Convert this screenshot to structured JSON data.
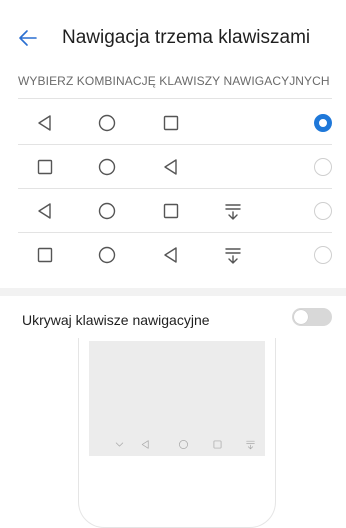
{
  "header": {
    "back_icon": "arrow-left-icon",
    "title": "Nawigacja trzema klawiszami"
  },
  "section": {
    "label": "WYBIERZ KOMBINACJĘ KLAWISZY NAWIGACYJNYCH"
  },
  "options": [
    {
      "keys": [
        "back-triangle-icon",
        "home-circle-icon",
        "recents-square-icon"
      ],
      "selected": true
    },
    {
      "keys": [
        "recents-square-icon",
        "home-circle-icon",
        "back-triangle-icon"
      ],
      "selected": false
    },
    {
      "keys": [
        "back-triangle-icon",
        "home-circle-icon",
        "recents-square-icon",
        "notification-pull-icon"
      ],
      "selected": false
    },
    {
      "keys": [
        "recents-square-icon",
        "home-circle-icon",
        "back-triangle-icon",
        "notification-pull-icon"
      ],
      "selected": false
    }
  ],
  "toggle": {
    "label": "Ukrywaj klawisze nawigacyjne",
    "enabled": false
  },
  "preview": {
    "keys": [
      "chevron-down-icon",
      "back-triangle-icon",
      "home-circle-icon",
      "recents-square-icon",
      "notification-pull-icon"
    ]
  },
  "colors": {
    "accent": "#1f78d9",
    "icon": "#555555",
    "divider": "#e3e3e3",
    "band": "#f2f2f2"
  }
}
